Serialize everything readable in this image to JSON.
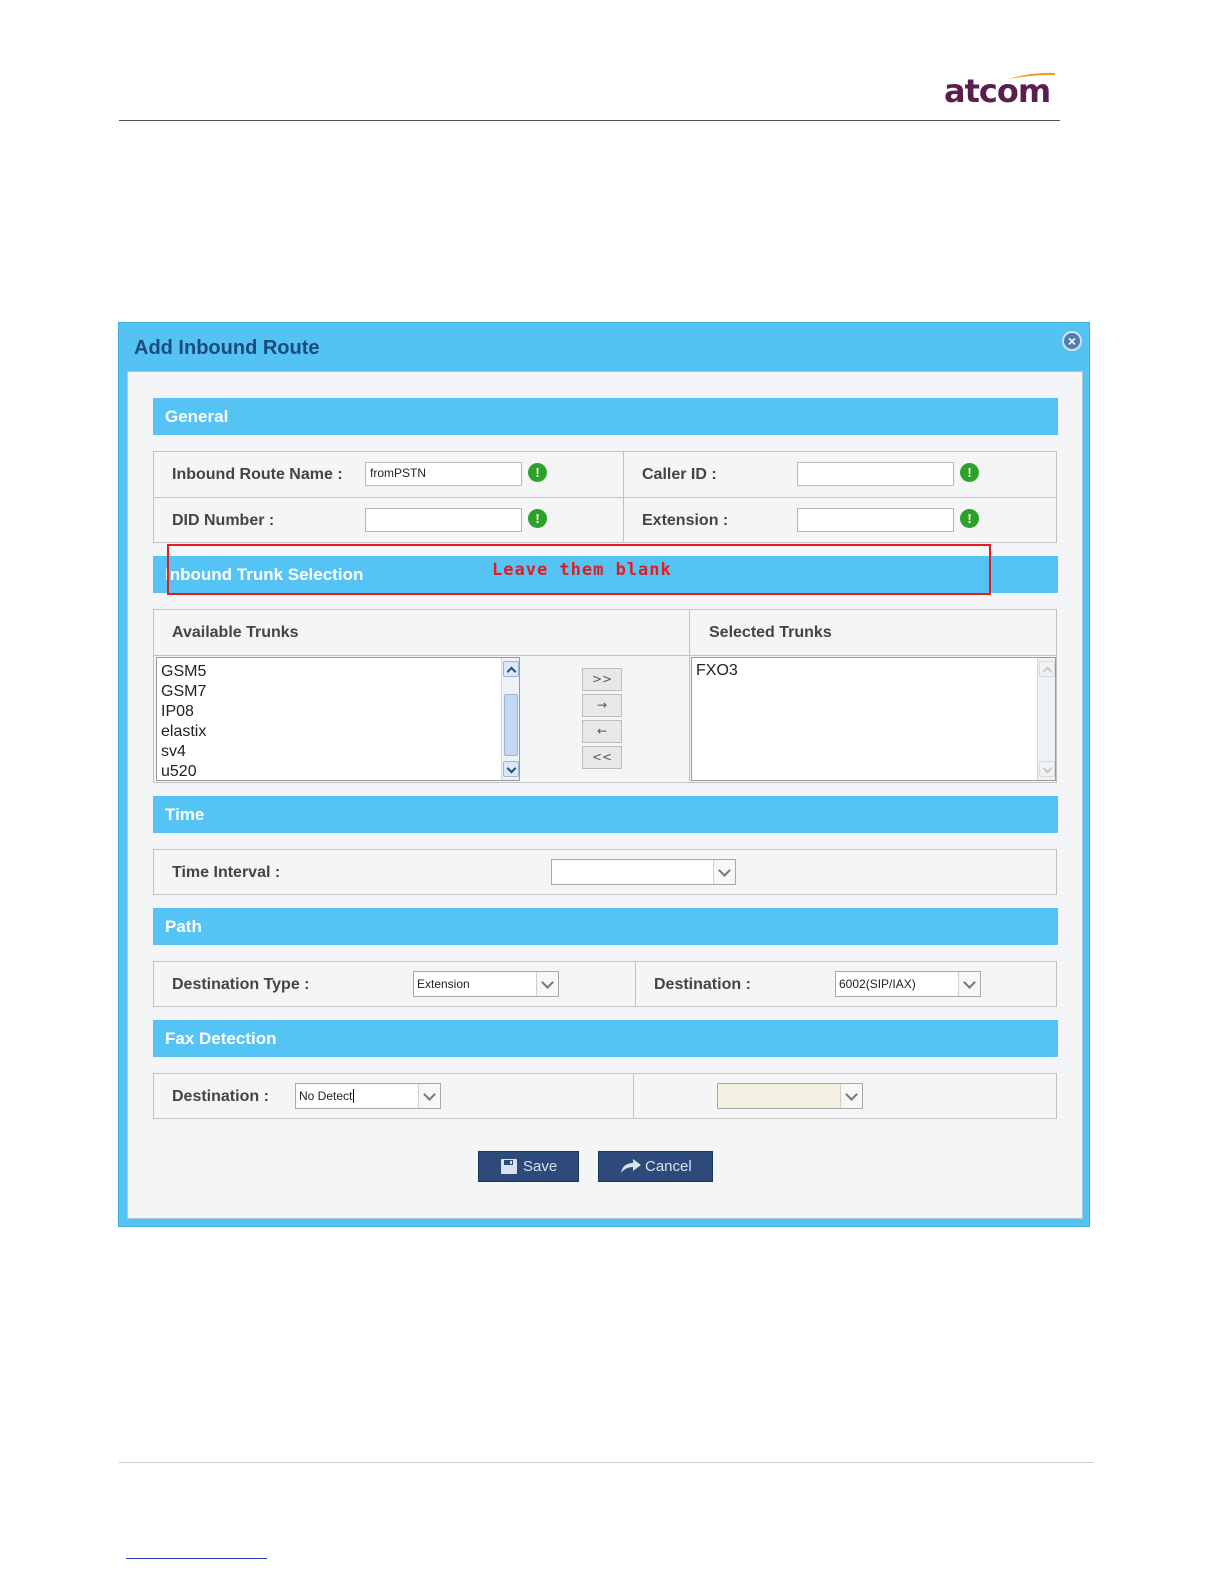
{
  "brand": {
    "logo_text": "atcom",
    "accent": "#f39a1e",
    "text_color": "#5a1f4f"
  },
  "dialog": {
    "title": "Add Inbound Route",
    "close_icon": "close-icon"
  },
  "general": {
    "header": "General",
    "route_name_label": "Inbound Route Name :",
    "route_name_value": "fromPSTN",
    "caller_id_label": "Caller ID :",
    "caller_id_value": "",
    "did_label": "DID Number :",
    "did_value": "",
    "extension_label": "Extension :",
    "extension_value": "",
    "warn_icon_glyph": "!"
  },
  "annotation": {
    "text": "Leave them blank",
    "color": "#e31b23"
  },
  "trunks": {
    "header": "Inbound Trunk Selection",
    "available_label": "Available Trunks",
    "selected_label": "Selected Trunks",
    "available": [
      "GSM5",
      "GSM7",
      "IP08",
      "elastix",
      "sv4",
      "u520"
    ],
    "selected": [
      "FXO3"
    ],
    "move_all_right": ">>",
    "move_right": "→",
    "move_left": "←",
    "move_all_left": "<<"
  },
  "time": {
    "header": "Time",
    "interval_label": "Time Interval :",
    "interval_value": ""
  },
  "path": {
    "header": "Path",
    "dest_type_label": "Destination Type :",
    "dest_type_value": "Extension",
    "dest_label": "Destination :",
    "dest_value": "6002(SIP/IAX)"
  },
  "fax": {
    "header": "Fax Detection",
    "dest_label": "Destination :",
    "dest_value": "No Detect",
    "secondary_value": ""
  },
  "buttons": {
    "save": "Save",
    "cancel": "Cancel"
  }
}
